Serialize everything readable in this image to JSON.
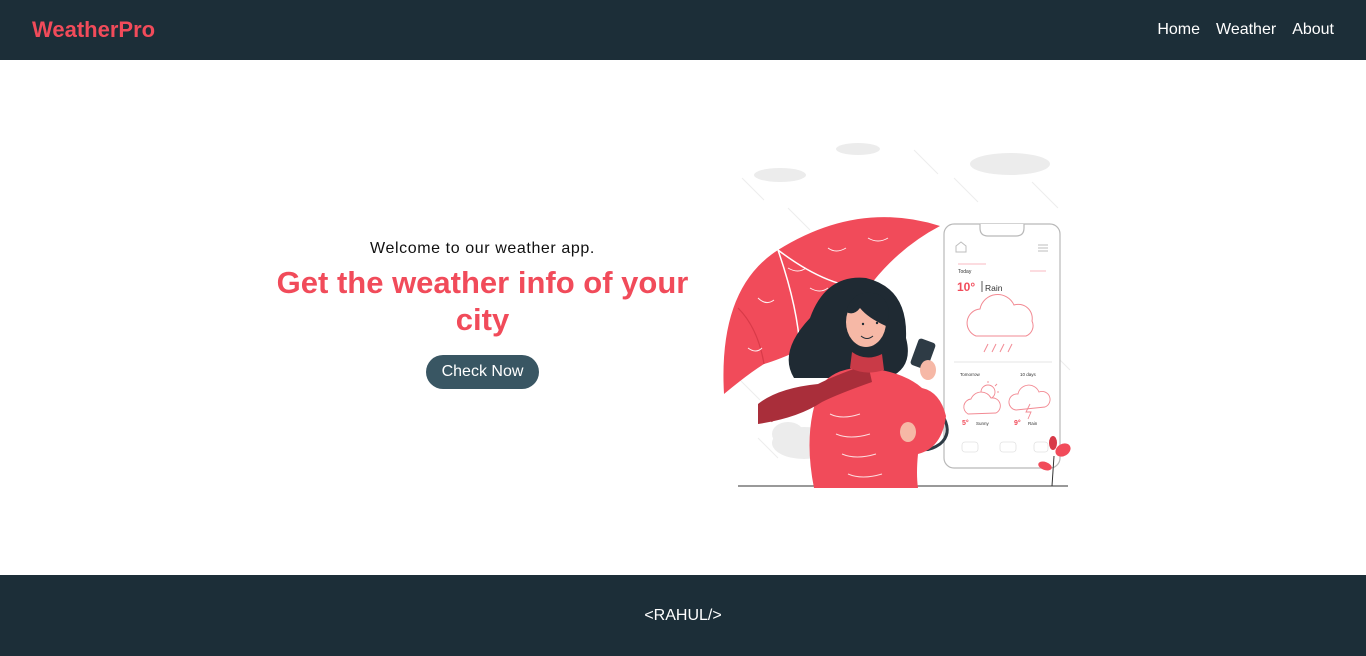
{
  "nav": {
    "brand": "WeatherPro",
    "links": [
      "Home",
      "Weather",
      "About"
    ]
  },
  "hero": {
    "welcome": "Welcome to our weather app.",
    "headline": "Get the weather info of your city",
    "cta_label": "Check Now"
  },
  "phone": {
    "today_label": "Today",
    "today_temp": "10°",
    "today_condition": "Rain",
    "tomorrow_label": "Tomorrow",
    "tomorrow_temp": "5°",
    "tomorrow_condition": "Sunny",
    "tendays_label": "10 days",
    "tendays_temp": "9°",
    "tendays_condition": "Rain"
  },
  "footer": {
    "text": "<RAHUL/>"
  },
  "colors": {
    "nav_bg": "#1c2e38",
    "accent": "#f14b5a",
    "button_bg": "#395663"
  }
}
